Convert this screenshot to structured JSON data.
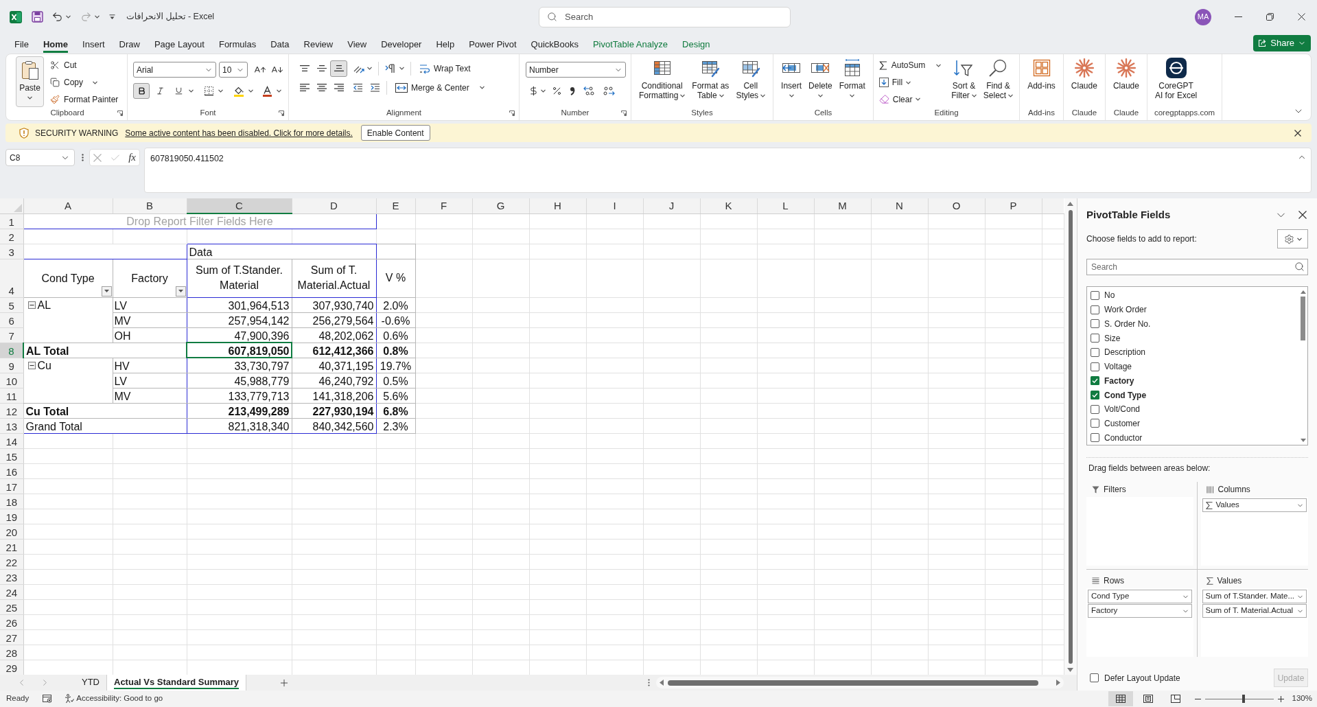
{
  "title_bar": {
    "title": "تحليل الانحرافات - Excel",
    "search": {
      "placeholder": "Search"
    },
    "avatar": "MA"
  },
  "menu_tabs": [
    {
      "label": "File",
      "selected": false,
      "kind": "core"
    },
    {
      "label": "Home",
      "selected": true,
      "kind": "core"
    },
    {
      "label": "Insert",
      "selected": false,
      "kind": "core"
    },
    {
      "label": "Draw",
      "selected": false,
      "kind": "core"
    },
    {
      "label": "Page Layout",
      "selected": false,
      "kind": "core"
    },
    {
      "label": "Formulas",
      "selected": false,
      "kind": "core"
    },
    {
      "label": "Data",
      "selected": false,
      "kind": "core"
    },
    {
      "label": "Review",
      "selected": false,
      "kind": "core"
    },
    {
      "label": "View",
      "selected": false,
      "kind": "core"
    },
    {
      "label": "Developer",
      "selected": false,
      "kind": "core"
    },
    {
      "label": "Help",
      "selected": false,
      "kind": "core"
    },
    {
      "label": "Power Pivot",
      "selected": false,
      "kind": "core"
    },
    {
      "label": "QuickBooks",
      "selected": false,
      "kind": "core"
    },
    {
      "label": "PivotTable Analyze",
      "selected": false,
      "kind": "contextual"
    },
    {
      "label": "Design",
      "selected": false,
      "kind": "contextual"
    }
  ],
  "share_button": "Share",
  "ribbon": {
    "groups": [
      {
        "kind": "clipboard",
        "label": "Clipboard",
        "paste": "Paste",
        "cut": "Cut",
        "copy": "Copy",
        "format_painter": "Format Painter"
      },
      {
        "kind": "font",
        "label": "Font",
        "font_name": "Arial",
        "font_size": "10",
        "bold": true,
        "italic": false,
        "underline": false
      },
      {
        "kind": "alignment",
        "label": "Alignment",
        "vertical": [
          {
            "kind": "top",
            "selected": false
          },
          {
            "kind": "middle",
            "selected": false
          },
          {
            "kind": "bottom",
            "selected": true
          }
        ],
        "horizontal": [
          {
            "kind": "left",
            "selected": false
          },
          {
            "kind": "center",
            "selected": false
          },
          {
            "kind": "right",
            "selected": false
          }
        ],
        "wrap_text": "Wrap Text",
        "merge": "Merge & Center"
      },
      {
        "kind": "number",
        "label": "Number",
        "format": "Number"
      },
      {
        "kind": "large",
        "label": "Styles",
        "buttons": [
          {
            "kind": "conditional",
            "lines": [
              "Conditional",
              "Formatting"
            ],
            "dropdown": true
          },
          {
            "kind": "table",
            "lines": [
              "Format as",
              "Table"
            ],
            "dropdown": true
          },
          {
            "kind": "cellstyles",
            "lines": [
              "Cell",
              "Styles"
            ],
            "dropdown": true
          }
        ]
      },
      {
        "kind": "large",
        "label": "Cells",
        "buttons": [
          {
            "kind": "insert",
            "lines": [
              "Insert"
            ],
            "dropdown": true
          },
          {
            "kind": "delete",
            "lines": [
              "Delete"
            ],
            "dropdown": true
          },
          {
            "kind": "format",
            "lines": [
              "Format"
            ],
            "dropdown": true
          }
        ]
      },
      {
        "kind": "editing",
        "label": "Editing",
        "autosum": "AutoSum",
        "fill": "Fill",
        "clear": "Clear",
        "buttons": [
          {
            "kind": "sort",
            "lines": [
              "Sort &",
              "Filter"
            ],
            "dropdown": true
          },
          {
            "kind": "find",
            "lines": [
              "Find &",
              "Select"
            ],
            "dropdown": true
          }
        ]
      },
      {
        "kind": "large",
        "label": "Add-ins",
        "buttons": [
          {
            "kind": "addins",
            "lines": [
              "Add-ins"
            ],
            "dropdown": false
          }
        ]
      },
      {
        "kind": "large",
        "label": "Claude",
        "buttons": [
          {
            "kind": "claude",
            "lines": [
              "Claude"
            ],
            "dropdown": false
          }
        ]
      },
      {
        "kind": "large",
        "label": "Claude",
        "buttons": [
          {
            "kind": "claude",
            "lines": [
              "Claude"
            ],
            "dropdown": false
          }
        ]
      },
      {
        "kind": "large",
        "label": "coregptapps.com",
        "buttons": [
          {
            "kind": "coregpt",
            "lines": [
              "CoreGPT",
              "AI for Excel"
            ],
            "dropdown": false
          }
        ]
      }
    ]
  },
  "security_warning": {
    "title": "SECURITY WARNING",
    "message": "Some active content has been disabled. Click for more details.",
    "button": "Enable Content"
  },
  "formula_bar": {
    "name_box": "C8",
    "function_label": "fx",
    "formula": "607819050.411502"
  },
  "sheet": {
    "columns": [
      {
        "label": "A",
        "selected": false
      },
      {
        "label": "B",
        "selected": false
      },
      {
        "label": "C",
        "selected": true
      },
      {
        "label": "D",
        "selected": false
      },
      {
        "label": "E",
        "selected": false
      },
      {
        "label": "F",
        "selected": false
      },
      {
        "label": "G",
        "selected": false
      },
      {
        "label": "H",
        "selected": false
      },
      {
        "label": "I",
        "selected": false
      },
      {
        "label": "J",
        "selected": false
      },
      {
        "label": "K",
        "selected": false
      },
      {
        "label": "L",
        "selected": false
      },
      {
        "label": "M",
        "selected": false
      },
      {
        "label": "N",
        "selected": false
      },
      {
        "label": "O",
        "selected": false
      },
      {
        "label": "P",
        "selected": false
      }
    ],
    "rows": [
      {
        "label": "1",
        "selected": false
      },
      {
        "label": "2",
        "selected": false
      },
      {
        "label": "3",
        "selected": false
      },
      {
        "label": "4",
        "selected": false
      },
      {
        "label": "5",
        "selected": false
      },
      {
        "label": "6",
        "selected": false
      },
      {
        "label": "7",
        "selected": false
      },
      {
        "label": "8",
        "selected": true
      },
      {
        "label": "9",
        "selected": false
      },
      {
        "label": "10",
        "selected": false
      },
      {
        "label": "11",
        "selected": false
      },
      {
        "label": "12",
        "selected": false
      },
      {
        "label": "13",
        "selected": false
      },
      {
        "label": "14",
        "selected": false
      },
      {
        "label": "15",
        "selected": false
      },
      {
        "label": "16",
        "selected": false
      },
      {
        "label": "17",
        "selected": false
      },
      {
        "label": "18",
        "selected": false
      },
      {
        "label": "19",
        "selected": false
      },
      {
        "label": "20",
        "selected": false
      },
      {
        "label": "21",
        "selected": false
      },
      {
        "label": "22",
        "selected": false
      },
      {
        "label": "23",
        "selected": false
      },
      {
        "label": "24",
        "selected": false
      },
      {
        "label": "25",
        "selected": false
      },
      {
        "label": "26",
        "selected": false
      },
      {
        "label": "27",
        "selected": false
      },
      {
        "label": "28",
        "selected": false
      },
      {
        "label": "29",
        "selected": false
      }
    ],
    "pivot": {
      "filter_hint": "Drop Report Filter Fields Here",
      "data_caption": "Data",
      "row_fields": [
        "Cond Type",
        "Factory"
      ],
      "value_headers": [
        "Sum of T.Stander. Material",
        "Sum of T. Material.Actual",
        "V %"
      ],
      "groups": [
        {
          "name": "AL",
          "expanded": true,
          "items": [
            {
              "label": "LV",
              "values": [
                "301,964,513",
                "307,930,740",
                "2.0%"
              ]
            },
            {
              "label": "MV",
              "values": [
                "257,954,142",
                "256,279,564",
                "-0.6%"
              ]
            },
            {
              "label": "OH",
              "values": [
                "47,900,396",
                "48,202,062",
                "0.6%"
              ]
            }
          ],
          "total": {
            "label": "AL Total",
            "values": [
              "607,819,050",
              "612,412,366",
              "0.8%"
            ]
          }
        },
        {
          "name": "Cu",
          "expanded": true,
          "items": [
            {
              "label": "HV",
              "values": [
                "33,730,797",
                "40,371,195",
                "19.7%"
              ]
            },
            {
              "label": "LV",
              "values": [
                "45,988,779",
                "46,240,792",
                "0.5%"
              ]
            },
            {
              "label": "MV",
              "values": [
                "133,779,713",
                "141,318,206",
                "5.6%"
              ]
            }
          ],
          "total": {
            "label": "Cu Total",
            "values": [
              "213,499,289",
              "227,930,194",
              "6.8%"
            ]
          }
        }
      ],
      "grand_total": {
        "label": "Grand Total",
        "values": [
          "821,318,340",
          "840,342,560",
          "2.3%"
        ]
      }
    },
    "tabs": [
      {
        "label": "YTD",
        "selected": false
      },
      {
        "label": "Actual Vs Standard Summary",
        "selected": true
      }
    ]
  },
  "pivot_fields_pane": {
    "title": "PivotTable Fields",
    "instruction": "Choose fields to add to report:",
    "search": {
      "placeholder": "Search"
    },
    "fields": [
      {
        "name": "No",
        "checked": false
      },
      {
        "name": "Work Order",
        "checked": false
      },
      {
        "name": "S. Order No.",
        "checked": false
      },
      {
        "name": "Size",
        "checked": false
      },
      {
        "name": "Description",
        "checked": false
      },
      {
        "name": "Voltage",
        "checked": false
      },
      {
        "name": "Factory",
        "checked": true
      },
      {
        "name": "Cond Type",
        "checked": true
      },
      {
        "name": "Volt/Cond",
        "checked": false
      },
      {
        "name": "Customer",
        "checked": false
      },
      {
        "name": "Conductor",
        "checked": false
      }
    ],
    "areas_instruction": "Drag fields between areas below:",
    "areas": [
      {
        "kind": "filters",
        "label": "Filters"
      },
      {
        "kind": "columns",
        "label": "Columns",
        "items": [
          {
            "kind": "values",
            "label": "Values"
          }
        ]
      },
      {
        "kind": "rows",
        "label": "Rows",
        "items": [
          {
            "kind": "field",
            "label": "Cond Type"
          },
          {
            "kind": "field",
            "label": "Factory"
          }
        ]
      },
      {
        "kind": "values",
        "label": "Values",
        "items": [
          {
            "kind": "field",
            "label": "Sum of T.Stander. Mate..."
          },
          {
            "kind": "field",
            "label": "Sum of T. Material.Actual"
          }
        ]
      }
    ],
    "defer_update": {
      "label": "Defer Layout Update",
      "checked": false
    },
    "update_button": {
      "label": "Update",
      "disabled": true
    }
  },
  "status_bar": {
    "status": "Ready",
    "accessibility": "Accessibility: Good to go",
    "views": [
      {
        "kind": "normal",
        "selected": true
      },
      {
        "kind": "page_layout",
        "selected": false
      },
      {
        "kind": "page_break",
        "selected": false
      }
    ],
    "zoom": {
      "level": 0.56,
      "label": "130%"
    }
  }
}
